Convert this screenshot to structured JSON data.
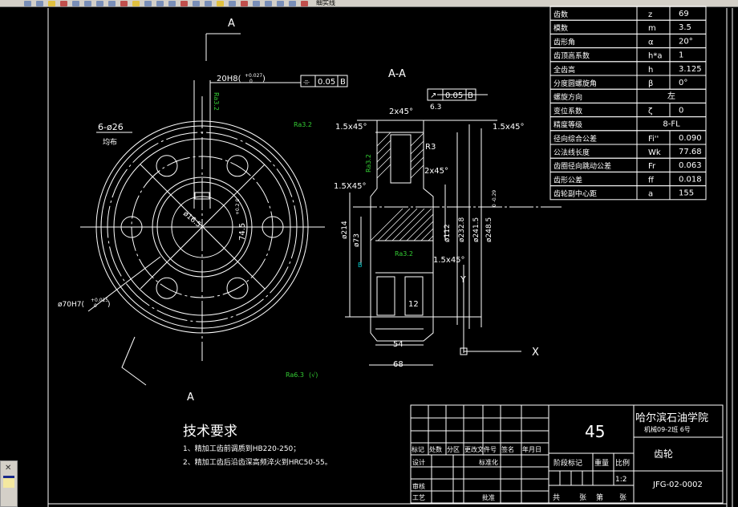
{
  "toolbar": {
    "layer_name": "细实线",
    "icons": [
      "new-icon",
      "open-icon",
      "save-icon",
      "print-icon",
      "preview-icon",
      "publish-icon",
      "cut-icon",
      "copy-icon",
      "paste-icon",
      "match-icon",
      "undo-icon",
      "redo-icon",
      "pan-icon",
      "zoom-realtime-icon",
      "zoom-window-icon",
      "zoom-previous-icon",
      "properties-icon",
      "design-center-icon",
      "tool-palette-icon",
      "sheet-set-icon",
      "markup-icon",
      "calc-icon",
      "help-icon",
      "layer-icon"
    ]
  },
  "drawing": {
    "section_label_top": "A",
    "section_label_bottom": "A",
    "section_view_title": "A-A",
    "keyway_dim": "20H8(",
    "keyway_tol_upper": "+0.027",
    "keyway_tol_lower": "0",
    "keyway_tol_close": ")",
    "symmetry_tol": {
      "symbol": "⌯",
      "value": "0.05",
      "datum": "B"
    },
    "runout_tol": {
      "symbol": "↗",
      "value": "0.05",
      "datum": "B"
    },
    "holes_dim": "6-ø26",
    "holes_note": "均布",
    "bore_dim": "ø70H7(",
    "bore_tol_upper": "+0.025",
    "bore_tol_lower": "0",
    "bore_tol_close": ")",
    "hub_radius_dim": "ø16.5",
    "keyway_depth_dim": "74.5",
    "keyway_depth_tol": "+0.2 0",
    "chamfers": [
      "2x45°",
      "1.5x45°",
      "1.5x45°",
      "2x45°",
      "1.5X45°",
      "1.5x45°"
    ],
    "radius_r3": "R3",
    "roughness_top": "6.3",
    "roughness": [
      "Ra3.2",
      "Ra3.2",
      "Ra3.2",
      "Ra3.2"
    ],
    "roughness_general": "Ra6.3",
    "roughness_general_suffix": "(√)",
    "diameters": [
      "ø214",
      "ø73",
      "ø112",
      "ø232.8",
      "ø241.5",
      "ø248.5"
    ],
    "outer_diameter_tol": "0 -0.29",
    "width_dims": [
      "12",
      "54",
      "68"
    ],
    "datum_label": "B",
    "ucs_x": "X",
    "ucs_y": "Y"
  },
  "gear_table": [
    {
      "name": "齿数",
      "symbol": "z",
      "value": "69"
    },
    {
      "name": "模数",
      "symbol": "m",
      "value": "3.5"
    },
    {
      "name": "齿形角",
      "symbol": "α",
      "value": "20°"
    },
    {
      "name": "齿顶高系数",
      "symbol": "h*a",
      "value": "1"
    },
    {
      "name": "全齿高",
      "symbol": "h",
      "value": "3.125"
    },
    {
      "name": "分度圆螺旋角",
      "symbol": "β",
      "value": "0°"
    },
    {
      "name": "螺旋方向",
      "symbol": "",
      "value": "左"
    },
    {
      "name": "变位系数",
      "symbol": "ζ",
      "value": "0"
    },
    {
      "name": "精度等级",
      "symbol": "",
      "value": "8-FL"
    },
    {
      "name": "径向综合公差",
      "symbol": "Fi''",
      "value": "0.090"
    },
    {
      "name": "公法线长度",
      "symbol": "Wk",
      "value": "77.68"
    },
    {
      "name": "齿圈径向跳动公差",
      "symbol": "Fr",
      "value": "0.063"
    },
    {
      "name": "齿形公差",
      "symbol": "ff",
      "value": "0.018"
    },
    {
      "name": "齿轮副中心距",
      "symbol": "a",
      "value": "155"
    }
  ],
  "tech_requirements": {
    "title": "技术要求",
    "items": [
      "1、精加工齿前调质到HB220-250；",
      "2、精加工齿后沿齿深高频淬火到HRC50-55。"
    ]
  },
  "title_block": {
    "rev_headers": [
      "标记",
      "处数",
      "分区",
      "更改文件号",
      "签名",
      "年月日"
    ],
    "design": "设计",
    "standardize": "标准化",
    "review": "审核",
    "process": "工艺",
    "approve": "批准",
    "material": "45",
    "stage_mark": "阶段标记",
    "weight": "重量",
    "scale_label": "比例",
    "scale": "1:2",
    "sheets": [
      "共",
      "张",
      "第",
      "张"
    ],
    "school": "哈尔滨石油学院",
    "class_info": "机械09-2班 6号",
    "part_name": "齿轮",
    "drawing_no": "JFG-02-0002"
  },
  "colors": {
    "background": "#000000",
    "lines": "#ffffff",
    "roughness": "#33cc33",
    "datum": "#00cccc"
  }
}
